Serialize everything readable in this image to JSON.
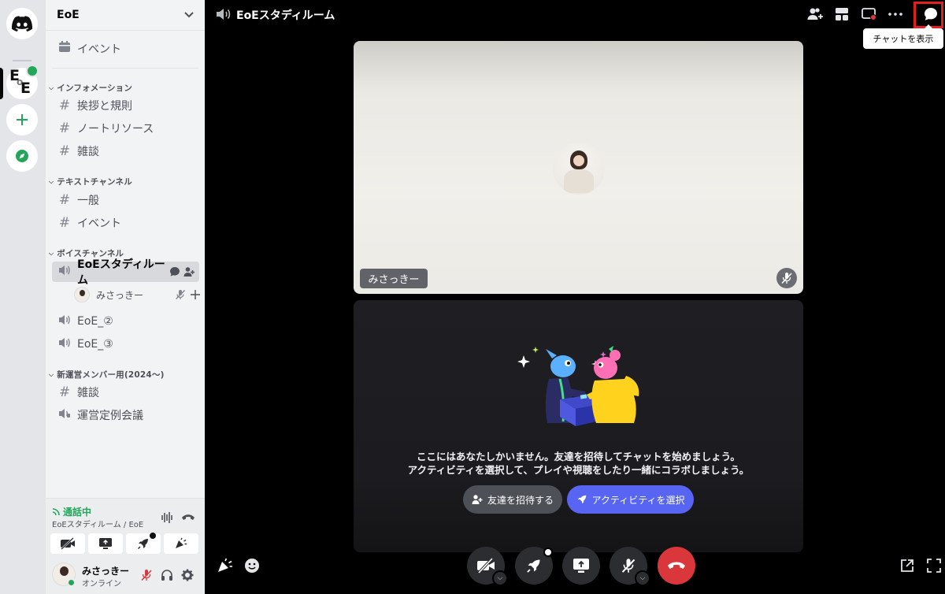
{
  "server": {
    "name": "EoE",
    "logo_text": [
      "E",
      "o",
      "E"
    ]
  },
  "sidebar": {
    "events_label": "イベント",
    "categories": [
      {
        "name": "インフォメーション",
        "channels": [
          "挨拶と規則",
          "ノートリソース",
          "雑談"
        ]
      },
      {
        "name": "テキストチャンネル",
        "channels": [
          "一般",
          "イベント"
        ]
      },
      {
        "name": "ボイスチャンネル",
        "channels": [
          "EoEスタディルーム",
          "EoE_②",
          "EoE_③"
        ]
      },
      {
        "name": "新運営メンバー用(2024〜)",
        "channels": [
          "雑談",
          "運営定例会議"
        ]
      }
    ],
    "voice_user": "みさっきー"
  },
  "voice_panel": {
    "status": "通話中",
    "location": "EoEスタディルーム / EoE"
  },
  "user_panel": {
    "name": "みさっきー",
    "status": "オンライン"
  },
  "main": {
    "channel_title": "EoEスタディルーム",
    "tooltip": "チャットを表示",
    "participant_name": "みさっきー",
    "empty_line1": "ここにはあなたしかいません。友達を招待してチャットを始めましょう。",
    "empty_line2": "アクティビティを選択して、プレイや視聴をしたり一緒にコラボしましょう。",
    "invite_button": "友達を招待する",
    "activity_button": "アクティビティを選択"
  },
  "colors": {
    "accent": "#5865f2",
    "online": "#23a55a",
    "danger": "#da373c",
    "highlight_box": "#e0201c"
  }
}
